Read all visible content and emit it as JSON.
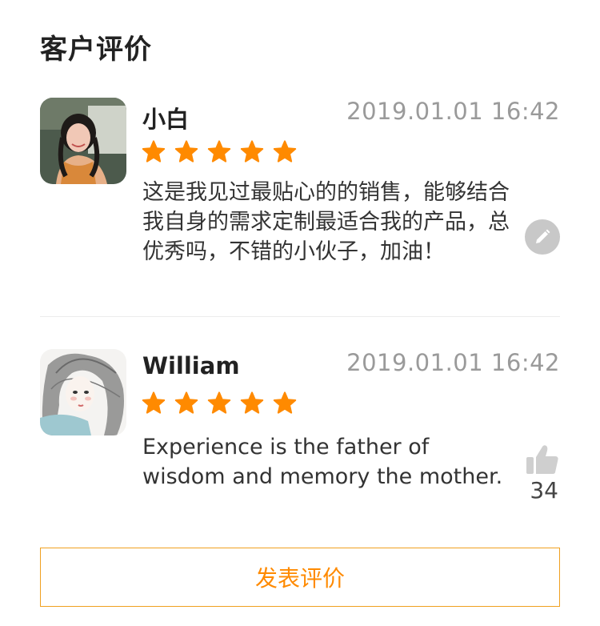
{
  "section": {
    "title": "客户评价"
  },
  "reviews": [
    {
      "name": "小白",
      "time": "2019.01.01 16:42",
      "rating": 5,
      "text": "这是我见过最贴心的的销售，能够结合我自身的需求定制最适合我的产品，总优秀吗，不错的小伙子，加油！",
      "action_icon": "edit-icon"
    },
    {
      "name": "William",
      "time": "2019.01.01 16:42",
      "rating": 5,
      "text": "Experience is the father of wisdom and memory the mother.",
      "action_icon": "thumbs-up-icon",
      "likes": "34"
    }
  ],
  "footer": {
    "post_label": "发表评价"
  },
  "colors": {
    "star": "#ff8a00",
    "accent": "#ff8a00",
    "border": "#f0a020",
    "muted": "#9a9a9a",
    "icon_gray": "#c8c8c8"
  }
}
